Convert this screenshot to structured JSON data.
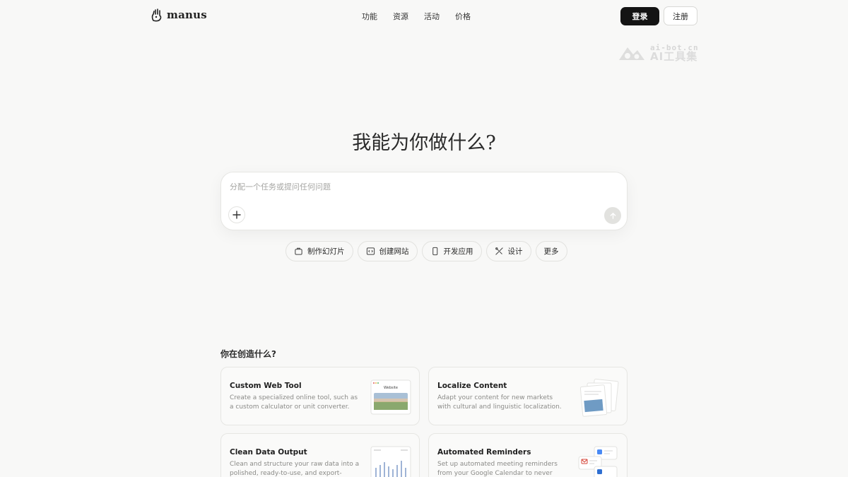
{
  "brand": {
    "name": "manus"
  },
  "nav": {
    "items": [
      {
        "label": "功能"
      },
      {
        "label": "资源"
      },
      {
        "label": "活动"
      },
      {
        "label": "价格"
      }
    ],
    "login_label": "登录",
    "signup_label": "注册"
  },
  "watermark": {
    "top": "ai-bot.cn",
    "bottom": "AI工具集"
  },
  "hero": {
    "title": "我能为你做什么?",
    "prompt_placeholder": "分配一个任务或提问任何问题"
  },
  "chips": [
    {
      "label": "制作幻灯片",
      "icon": "slides-icon"
    },
    {
      "label": "创建网站",
      "icon": "code-window-icon"
    },
    {
      "label": "开发应用",
      "icon": "phone-icon"
    },
    {
      "label": "设计",
      "icon": "design-tools-icon"
    },
    {
      "label": "更多",
      "icon": ""
    }
  ],
  "section": {
    "title": "你在创造什么?",
    "cards": [
      {
        "title": "Custom Web Tool",
        "desc": "Create a specialized online tool, such as a custom calculator or unit converter.",
        "thumb": "website-preview",
        "thumb_label": "Website"
      },
      {
        "title": "Localize Content",
        "desc": "Adapt your content for new markets with cultural and linguistic localization.",
        "thumb": "stacked-documents"
      },
      {
        "title": "Clean Data Output",
        "desc": "Clean and structure your raw data into a polished, ready-to-use, and export-",
        "thumb": "bar-chart"
      },
      {
        "title": "Automated Reminders",
        "desc": "Set up automated meeting reminders from your Google Calendar to never",
        "thumb": "app-icons"
      }
    ]
  },
  "colors": {
    "background": "#f8f8f7",
    "primary_button": "#141414",
    "border": "#e6e6e3",
    "chart_bar": "#9fb4d6"
  }
}
